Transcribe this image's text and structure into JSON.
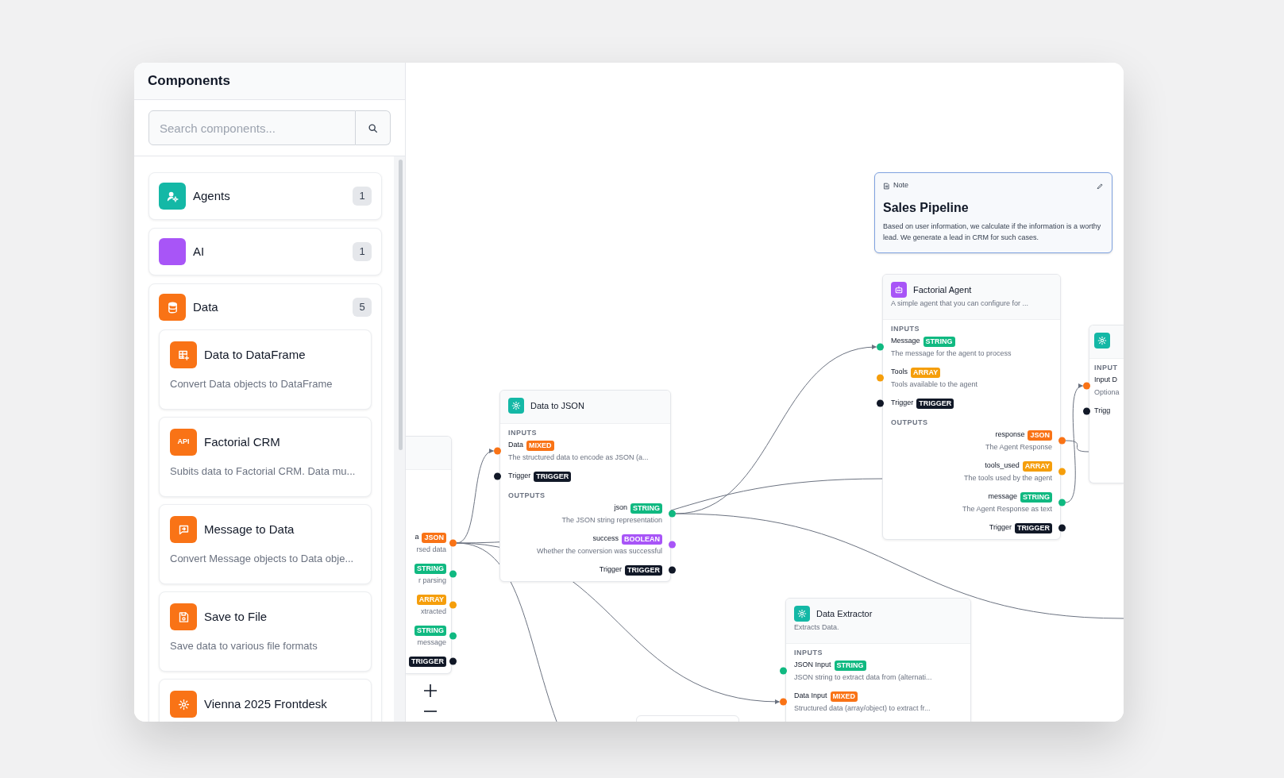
{
  "sidebar": {
    "title": "Components",
    "search": {
      "placeholder": "Search components..."
    },
    "categories": [
      {
        "name": "Agents",
        "count": "1",
        "color": "#14b8a6"
      },
      {
        "name": "AI",
        "count": "1",
        "color": "#a855f7"
      },
      {
        "name": "Data",
        "count": "5",
        "color": "#f97316",
        "items": [
          {
            "title": "Data to DataFrame",
            "description": "Convert Data objects to DataFrame"
          },
          {
            "title": "Factorial CRM",
            "icon_label": "API",
            "description": "Subits data to Factorial CRM. Data mu..."
          },
          {
            "title": "Message to Data",
            "description": "Convert Message objects to Data obje..."
          },
          {
            "title": "Save to File",
            "description": "Save data to various file formats"
          },
          {
            "title": "Vienna 2025 Frontdesk"
          }
        ]
      }
    ]
  },
  "canvas": {
    "nodes": [
      {
        "kind": "note",
        "selected": true,
        "label": "Note",
        "title": "Sales Pipeline",
        "text": "Based on user information, we calculate if the information is a worthy lead. We generate a lead in CRM for such cases."
      },
      {
        "kind": "component",
        "selected": false,
        "title": "Factorial Agent",
        "description": "A simple agent that you can configure for ...",
        "color": "#a855f7",
        "inputs_label": "INPUTS",
        "inputs": [
          {
            "name": "Message",
            "type": "STRING",
            "color": "#10b981",
            "description": "The message for the agent to process"
          },
          {
            "name": "Tools",
            "type": "ARRAY",
            "color": "#f59e0b",
            "description": "Tools available to the agent"
          },
          {
            "name": "Trigger",
            "type": "TRIGGER",
            "color": "#111827"
          }
        ],
        "outputs_label": "OUTPUTS",
        "outputs": [
          {
            "name": "response",
            "type": "JSON",
            "color": "#f97316",
            "description": "The Agent Response"
          },
          {
            "name": "tools_used",
            "type": "ARRAY",
            "color": "#f59e0b",
            "description": "The tools used by the agent"
          },
          {
            "name": "message",
            "type": "STRING",
            "color": "#10b981",
            "description": "The Agent Response as text"
          },
          {
            "name": "Trigger",
            "type": "TRIGGER",
            "color": "#111827"
          }
        ]
      },
      {
        "kind": "component",
        "selected": false,
        "color": "#14b8a6",
        "inputs_label": "INPUT",
        "inputs": [
          {
            "name": "Input D",
            "color": "#f97316",
            "description": "Optiona"
          },
          {
            "name": "Trigg",
            "color": "#111827"
          }
        ]
      },
      {
        "kind": "component",
        "selected": false,
        "title": "Data to JSON",
        "color": "#14b8a6",
        "inputs_label": "INPUTS",
        "inputs": [
          {
            "name": "Data",
            "type": "MIXED",
            "color": "#f97316",
            "description": "The structured data to encode as JSON (a..."
          },
          {
            "name": "Trigger",
            "type": "TRIGGER",
            "color": "#111827"
          }
        ],
        "outputs_label": "OUTPUTS",
        "outputs": [
          {
            "name": "json",
            "type": "STRING",
            "color": "#10b981",
            "description": "The JSON string representation"
          },
          {
            "name": "success",
            "type": "BOOLEAN",
            "color": "#a855f7",
            "description": "Whether the conversion was successful"
          },
          {
            "name": "Trigger",
            "type": "TRIGGER",
            "color": "#111827"
          }
        ]
      },
      {
        "kind": "component",
        "selected": false,
        "outputs": [
          {
            "name": "a",
            "type": "JSON",
            "color": "#f97316",
            "description": "rsed data"
          },
          {
            "type": "STRING",
            "color": "#10b981",
            "description": "r parsing"
          },
          {
            "type": "ARRAY",
            "color": "#f59e0b",
            "description": "xtracted"
          },
          {
            "type": "STRING",
            "color": "#10b981",
            "description": "message"
          },
          {
            "type": "TRIGGER",
            "color": "#111827"
          }
        ]
      },
      {
        "kind": "component",
        "selected": false,
        "title": "Data Extractor",
        "description": "Extracts Data.",
        "color": "#14b8a6",
        "inputs_label": "INPUTS",
        "inputs": [
          {
            "name": "JSON Input",
            "type": "STRING",
            "color": "#10b981",
            "description": "JSON string to extract data from (alternati..."
          },
          {
            "name": "Data Input",
            "type": "MIXED",
            "color": "#f97316",
            "description": "Structured data (array/object) to extract fr..."
          }
        ]
      }
    ]
  }
}
